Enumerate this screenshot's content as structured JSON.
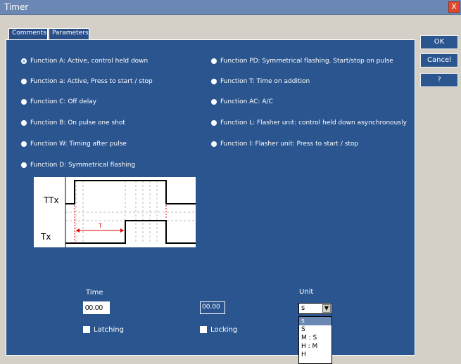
{
  "window": {
    "title": "Timer",
    "close_label": "X"
  },
  "tabs": [
    {
      "label": "Comments"
    },
    {
      "label": "Parameters"
    }
  ],
  "buttons": {
    "ok": "OK",
    "cancel": "Cancel",
    "help": "?"
  },
  "functions_left": [
    {
      "label": "Function A: Active, control held down",
      "selected": true
    },
    {
      "label": "Function a: Active, Press to start / stop",
      "selected": false
    },
    {
      "label": "Function C: Off delay",
      "selected": false
    },
    {
      "label": "Function B: On pulse one shot",
      "selected": false
    },
    {
      "label": "Function W: Timing after pulse",
      "selected": false
    },
    {
      "label": "Function D: Symmetrical flashing",
      "selected": false
    }
  ],
  "functions_right": [
    {
      "label": "Function PD: Symmetrical flashing. Start/stop on pulse",
      "selected": false
    },
    {
      "label": "Function T: Time on addition",
      "selected": false
    },
    {
      "label": "Function AC: A/C",
      "selected": false
    },
    {
      "label": "Function L: Flasher unit: control held down asynchronously",
      "selected": false
    },
    {
      "label": "Function l: Flasher unit: Press to start / stop",
      "selected": false
    }
  ],
  "diagram": {
    "ttx_label": "TTx",
    "tx_label": "Tx",
    "t_label": "T"
  },
  "time": {
    "label": "Time",
    "value": "00.00",
    "display": "00.00"
  },
  "unit": {
    "label": "Unit",
    "value": "s",
    "options": [
      "s",
      "S",
      "M : S",
      "H : M",
      "H"
    ]
  },
  "latching": {
    "label": "Latching"
  },
  "locking": {
    "label": "Locking"
  }
}
